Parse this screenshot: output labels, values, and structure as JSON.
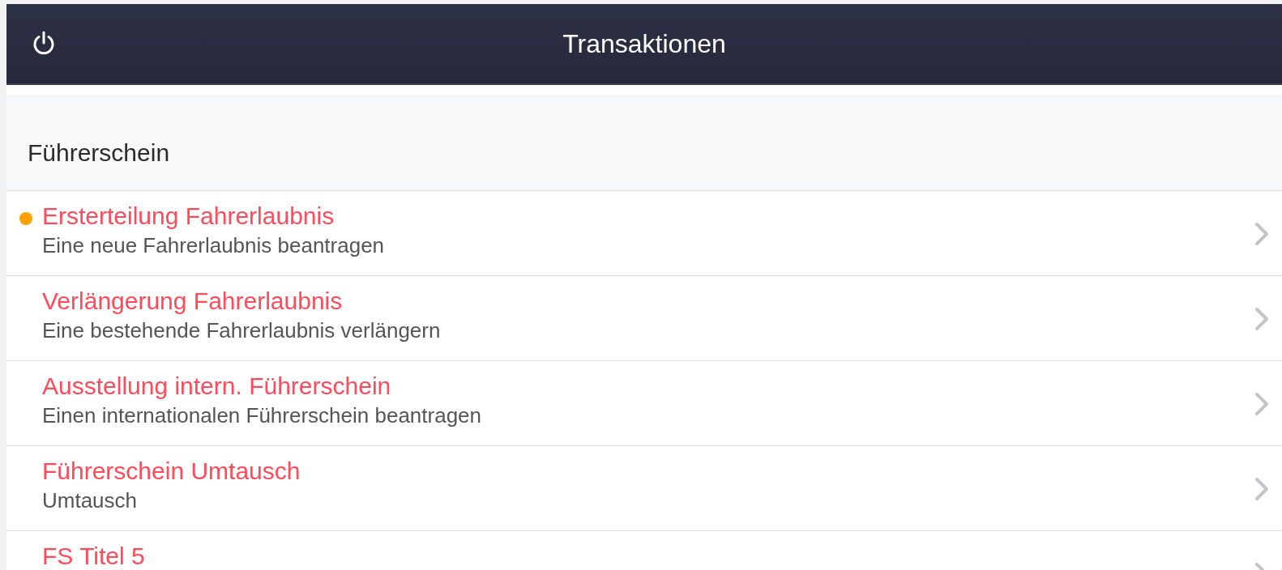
{
  "header": {
    "title": "Transaktionen"
  },
  "section": {
    "title": "Führerschein"
  },
  "items": [
    {
      "title": "Ersterteilung Fahrerlaubnis",
      "subtitle": "Eine neue Fahrerlaubnis beantragen",
      "unread": true
    },
    {
      "title": "Verlängerung Fahrerlaubnis",
      "subtitle": "Eine bestehende Fahrerlaubnis verlängern",
      "unread": false
    },
    {
      "title": "Ausstellung intern. Führerschein",
      "subtitle": "Einen internationalen Führerschein beantragen",
      "unread": false
    },
    {
      "title": "Führerschein Umtausch",
      "subtitle": "Umtausch",
      "unread": false
    },
    {
      "title": "FS Titel 5",
      "unread": false
    }
  ]
}
